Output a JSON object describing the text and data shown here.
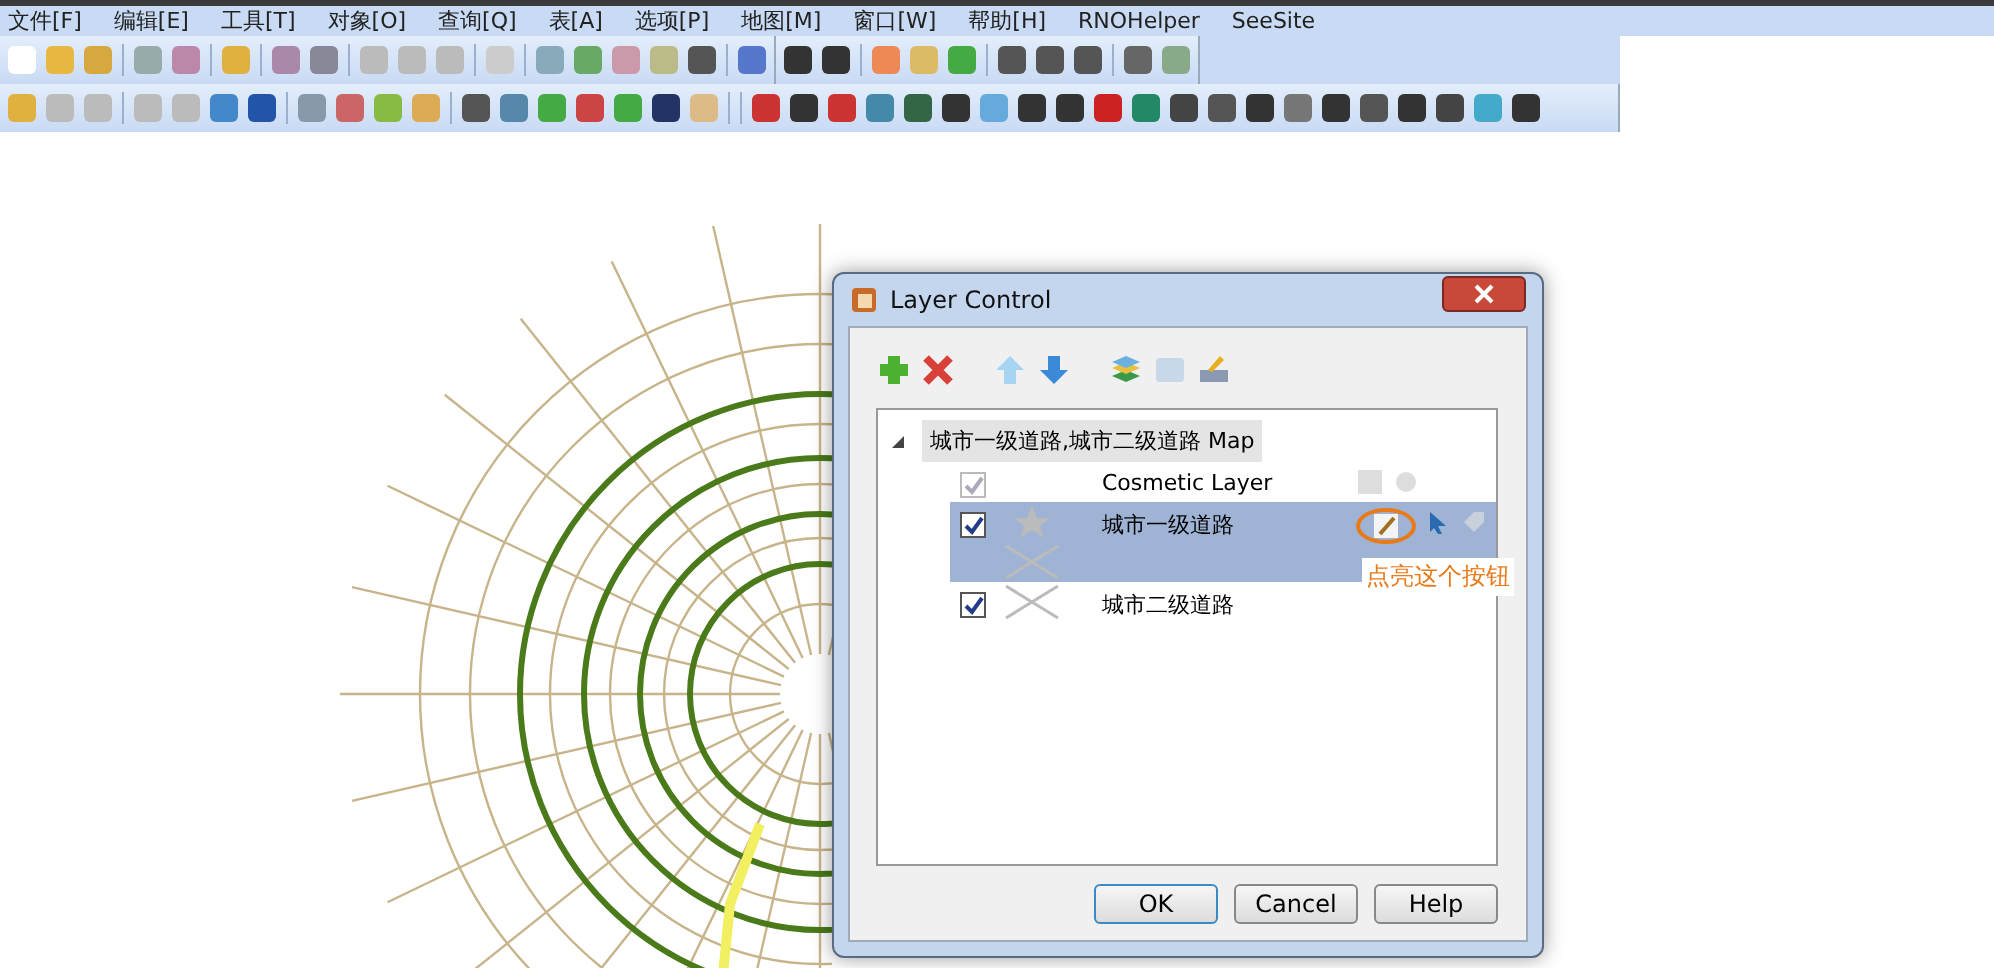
{
  "menu": [
    "文件[F]",
    "编辑[E]",
    "工具[T]",
    "对象[O]",
    "查询[Q]",
    "表[A]",
    "选项[P]",
    "地图[M]",
    "窗口[W]",
    "帮助[H]",
    "RNOHelper",
    "SeeSite"
  ],
  "dialog": {
    "title": "Layer Control",
    "tree": {
      "label": "城市一级道路,城市二级道路 Map",
      "expanded": true,
      "children": [
        {
          "label": "Cosmetic Layer",
          "checked": true,
          "disabled": true,
          "selected": false,
          "kind": "cosmetic"
        },
        {
          "label": "城市一级道路",
          "checked": true,
          "disabled": false,
          "selected": true,
          "kind": "line"
        },
        {
          "label": "城市二级道路",
          "checked": true,
          "disabled": false,
          "selected": false,
          "kind": "line"
        }
      ]
    },
    "annotation": "点亮这个按钮",
    "buttons": [
      "OK",
      "Cancel",
      "Help"
    ]
  }
}
